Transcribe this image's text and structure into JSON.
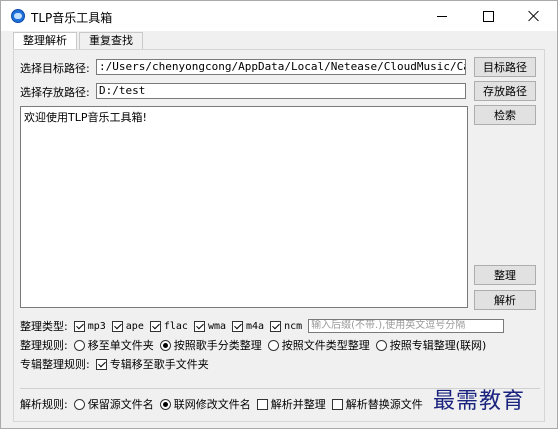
{
  "window": {
    "title": "TLP音乐工具箱",
    "controls": {
      "minimize": "minimize",
      "maximize": "maximize",
      "close": "close"
    }
  },
  "tabs": [
    {
      "label": "整理解析",
      "active": true
    },
    {
      "label": "重复查找",
      "active": false
    }
  ],
  "paths": {
    "target_label": "选择目标路径:",
    "target_value": ":/Users/chenyongcong/AppData/Local/Netease/CloudMusic/Cache/Cache",
    "target_button": "目标路径",
    "save_label": "选择存放路径:",
    "save_value": "D:/test",
    "save_button": "存放路径"
  },
  "actions": {
    "search": "检索",
    "organize": "整理",
    "parse": "解析"
  },
  "log": {
    "text": "欢迎使用TLP音乐工具箱!"
  },
  "organize_type": {
    "label": "整理类型:",
    "formats": [
      {
        "name": "mp3",
        "checked": true
      },
      {
        "name": "ape",
        "checked": true
      },
      {
        "name": "flac",
        "checked": true
      },
      {
        "name": "wma",
        "checked": true
      },
      {
        "name": "m4a",
        "checked": true
      },
      {
        "name": "ncm",
        "checked": true
      }
    ],
    "ext_placeholder": "输入后缀(不带.),使用英文逗号分隔"
  },
  "organize_rule": {
    "label": "整理规则:",
    "options": [
      {
        "label": "移至单文件夹",
        "selected": false
      },
      {
        "label": "按照歌手分类整理",
        "selected": true
      },
      {
        "label": "按照文件类型整理",
        "selected": false
      },
      {
        "label": "按照专辑整理(联网)",
        "selected": false
      }
    ]
  },
  "album_rule": {
    "label": "专辑整理规则:",
    "option": {
      "label": "专辑移至歌手文件夹",
      "checked": true
    }
  },
  "parse_rule": {
    "label": "解析规则:",
    "options": [
      {
        "type": "radio",
        "label": "保留源文件名",
        "selected": false
      },
      {
        "type": "radio",
        "label": "联网修改文件名",
        "selected": true
      },
      {
        "type": "checkbox",
        "label": "解析并整理",
        "checked": false
      },
      {
        "type": "checkbox",
        "label": "解析替换源文件",
        "checked": false
      }
    ]
  },
  "watermark": "最需教育"
}
